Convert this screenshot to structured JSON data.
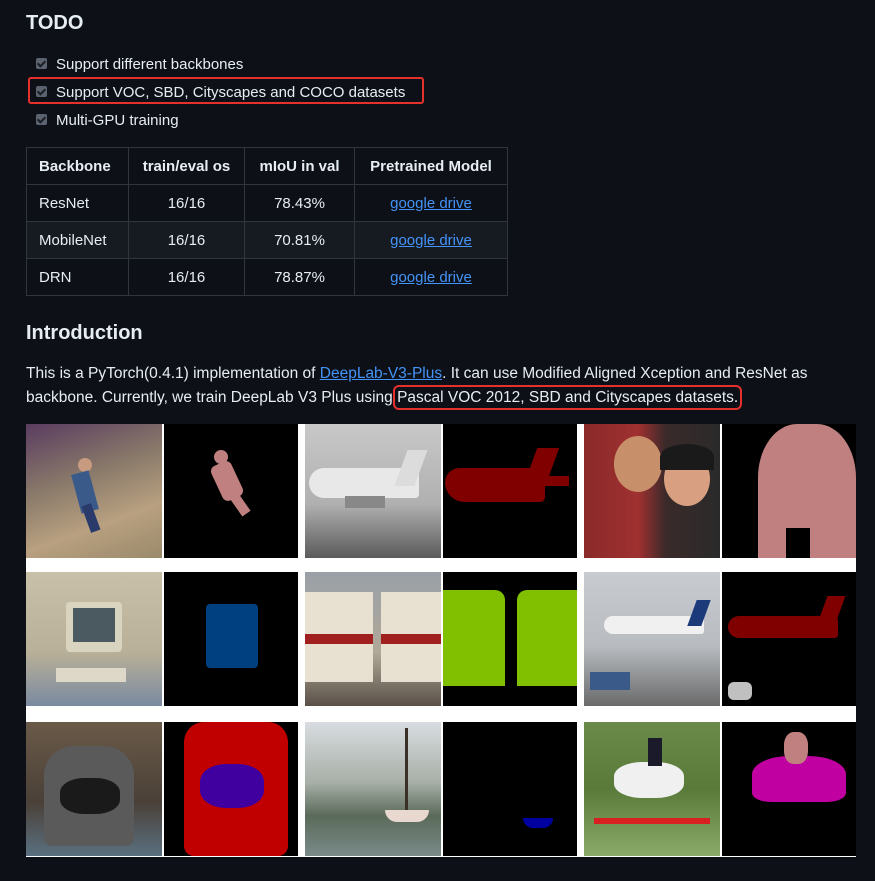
{
  "todo": {
    "title": "TODO",
    "tasks": [
      {
        "label": "Support different backbones",
        "checked": true
      },
      {
        "label": "Support VOC, SBD, Cityscapes and COCO datasets",
        "checked": true
      },
      {
        "label": "Multi-GPU training",
        "checked": true
      }
    ]
  },
  "table": {
    "headers": [
      "Backbone",
      "train/eval os",
      "mIoU in val",
      "Pretrained Model"
    ],
    "rows": [
      {
        "backbone": "ResNet",
        "os": "16/16",
        "miou": "78.43%",
        "link": "google drive"
      },
      {
        "backbone": "MobileNet",
        "os": "16/16",
        "miou": "70.81%",
        "link": "google drive"
      },
      {
        "backbone": "DRN",
        "os": "16/16",
        "miou": "78.87%",
        "link": "google drive"
      }
    ]
  },
  "intro": {
    "title": "Introduction",
    "text_before": "This is a PyTorch(0.4.1) implementation of ",
    "link": "DeepLab-V3-Plus",
    "text_middle": ". It can use Modified Aligned Xception and ResNet as backbone. Currently, we train DeepLab V3 Plus using ",
    "highlight": "Pascal VOC 2012, SBD and Cityscapes datasets."
  },
  "colors": {
    "link": "#4493f8",
    "highlight_border": "#e5302c",
    "seg_person": "#c08080",
    "seg_aeroplane": "#800000",
    "seg_monitor": "#004080",
    "seg_train": "#80c000",
    "seg_chair": "#c00000",
    "seg_dog": "#4000a0",
    "seg_boat": "#0000a0",
    "seg_horse": "#c000a0"
  }
}
